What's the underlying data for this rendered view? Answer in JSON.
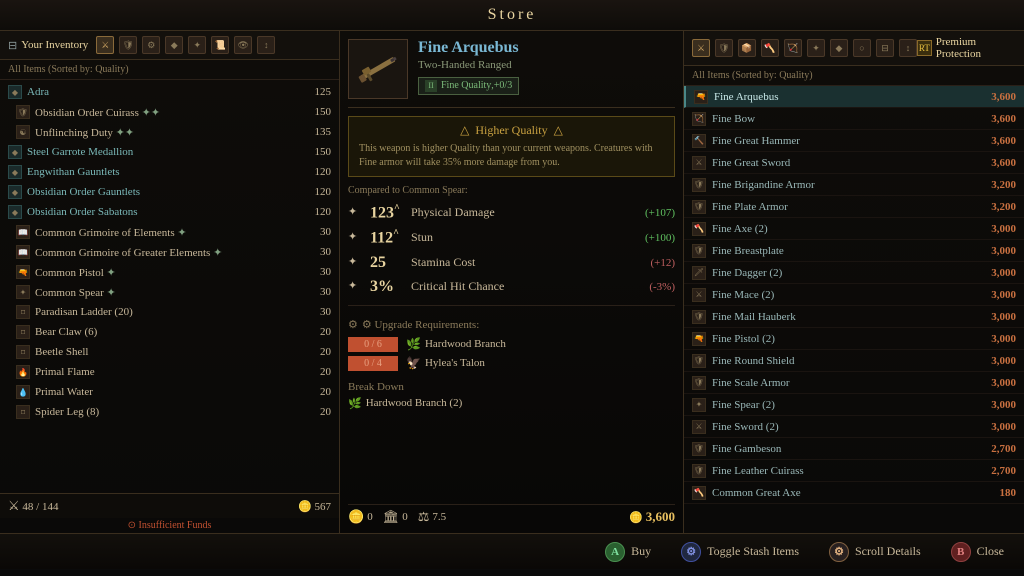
{
  "topbar": {
    "title": "Store",
    "left_hint": "◀",
    "right_hint": "▶"
  },
  "left_panel": {
    "header_title": "Your Inventory",
    "sort_label": "All Items (Sorted by: Quality)",
    "icons": [
      "⚔",
      "🛡",
      "⚙",
      "✦",
      "⚡",
      "🔮",
      "👁"
    ],
    "items": [
      {
        "name": "Adra",
        "price": "125",
        "special": false,
        "icon": "◆",
        "color": "teal"
      },
      {
        "name": "Obsidian Order Cuirass ✦✦",
        "price": "150",
        "special": false,
        "icon": "🛡",
        "color": "normal"
      },
      {
        "name": "Unflinching Duty ✦✦",
        "price": "135",
        "special": false,
        "icon": "☯",
        "color": "normal"
      },
      {
        "name": "Steel Garrote Medallion",
        "price": "150",
        "special": false,
        "icon": "◆",
        "color": "teal"
      },
      {
        "name": "Engwithan Gauntlets",
        "price": "120",
        "special": false,
        "icon": "◆",
        "color": "teal"
      },
      {
        "name": "Obsidian Order Gauntlets",
        "price": "120",
        "special": false,
        "icon": "◆",
        "color": "teal"
      },
      {
        "name": "Obsidian Order Sabatons",
        "price": "120",
        "special": false,
        "icon": "◆",
        "color": "teal"
      },
      {
        "name": "Common Grimoire of Elements ✦",
        "price": "30",
        "special": false,
        "icon": "📖",
        "color": "normal"
      },
      {
        "name": "Common Grimoire of Greater Elements ✦",
        "price": "30",
        "special": false,
        "icon": "📖",
        "color": "normal"
      },
      {
        "name": "Common Pistol ✦",
        "price": "30",
        "special": false,
        "icon": "🔫",
        "color": "normal"
      },
      {
        "name": "Common Spear ✦",
        "price": "30",
        "special": false,
        "icon": "✦",
        "color": "normal"
      },
      {
        "name": "Paradisan Ladder (20)",
        "price": "30",
        "special": false,
        "icon": "⌑",
        "color": "normal"
      },
      {
        "name": "Bear Claw (6)",
        "price": "20",
        "special": false,
        "icon": "⌑",
        "color": "normal"
      },
      {
        "name": "Beetle Shell",
        "price": "20",
        "special": false,
        "icon": "⌑",
        "color": "normal"
      },
      {
        "name": "Primal Flame",
        "price": "20",
        "special": false,
        "icon": "⌑",
        "color": "normal"
      },
      {
        "name": "Primal Water",
        "price": "20",
        "special": false,
        "icon": "⌑",
        "color": "normal"
      },
      {
        "name": "Spider Leg (8)",
        "price": "20",
        "special": false,
        "icon": "⌑",
        "color": "normal"
      }
    ],
    "footer_left": "⚔ 48 / 144",
    "footer_gold": "567",
    "insufficient_label": "⊙ Insufficient Funds"
  },
  "mid_panel": {
    "item_name": "Fine Arquebus",
    "item_type": "Two-Handed Ranged",
    "quality_label": "Fine Quality",
    "quality_upgrade": "+0/3",
    "higher_quality_title": "Higher Quality",
    "higher_quality_text": "This weapon is higher Quality than your current weapons. Creatures with Fine armor will take 35% more damage from you.",
    "compared_label": "Compared to Common Spear:",
    "stats": [
      {
        "icon": "✦",
        "value": "123",
        "modifier": "^",
        "name": "Physical Damage",
        "change": "+107",
        "positive": true
      },
      {
        "icon": "✦",
        "value": "112",
        "modifier": "^",
        "name": "Stun",
        "change": "+100",
        "positive": true
      },
      {
        "icon": "✦",
        "value": "25",
        "modifier": "",
        "name": "Stamina Cost",
        "change": "+12",
        "positive": false
      },
      {
        "icon": "✦",
        "value": "3%",
        "modifier": "",
        "name": "Critical Hit Chance",
        "change": "-3%",
        "positive": false
      }
    ],
    "upgrade_title": "⚙ Upgrade Requirements:",
    "upgrades": [
      {
        "current": "0",
        "max": "6",
        "name": "Hardwood Branch",
        "icon": "🌿"
      },
      {
        "current": "0",
        "max": "4",
        "name": "Hylea's Talon",
        "icon": "🦅"
      }
    ],
    "breakdown_title": "Break Down",
    "breakdown_items": [
      {
        "icon": "🌿",
        "name": "Hardwood Branch (2)"
      }
    ],
    "footer": {
      "copper": "0",
      "silver": "0",
      "weight": "7.5",
      "price": "3,600"
    }
  },
  "right_panel": {
    "header_title": "Premium Protection",
    "sort_label": "All Items (Sorted by: Quality)",
    "items": [
      {
        "name": "Fine Arquebus",
        "price": "3,600",
        "icon": "🔫",
        "selected": true
      },
      {
        "name": "Fine Bow",
        "price": "3,600",
        "icon": "🏹"
      },
      {
        "name": "Fine Great Hammer",
        "price": "3,600",
        "icon": "🔨"
      },
      {
        "name": "Fine Great Sword",
        "price": "3,600",
        "icon": "⚔"
      },
      {
        "name": "Fine Brigandine Armor",
        "price": "3,200",
        "icon": "🛡"
      },
      {
        "name": "Fine Plate Armor",
        "price": "3,200",
        "icon": "🛡"
      },
      {
        "name": "Fine Axe (2)",
        "price": "3,000",
        "icon": "🪓"
      },
      {
        "name": "Fine Breastplate",
        "price": "3,000",
        "icon": "🛡"
      },
      {
        "name": "Fine Dagger (2)",
        "price": "3,000",
        "icon": "🗡"
      },
      {
        "name": "Fine Mace (2)",
        "price": "3,000",
        "icon": "⚔"
      },
      {
        "name": "Fine Mail Hauberk",
        "price": "3,000",
        "icon": "🛡"
      },
      {
        "name": "Fine Pistol (2)",
        "price": "3,000",
        "icon": "🔫"
      },
      {
        "name": "Fine Round Shield",
        "price": "3,000",
        "icon": "🛡"
      },
      {
        "name": "Fine Scale Armor",
        "price": "3,000",
        "icon": "🛡"
      },
      {
        "name": "Fine Spear (2)",
        "price": "3,000",
        "icon": "✦"
      },
      {
        "name": "Fine Sword (2)",
        "price": "3,000",
        "icon": "⚔"
      },
      {
        "name": "Fine Gambeson",
        "price": "2,700",
        "icon": "🛡"
      },
      {
        "name": "Fine Leather Cuirass",
        "price": "2,700",
        "icon": "🛡"
      },
      {
        "name": "Common Great Axe",
        "price": "180",
        "icon": "🪓"
      }
    ]
  },
  "bottom_bar": {
    "buy_label": "Buy",
    "toggle_label": "Toggle Stash Items",
    "scroll_label": "Scroll Details",
    "close_label": "Close",
    "btn_a": "A",
    "btn_toggle": "⚙",
    "btn_scroll": "⚙",
    "btn_b": "B"
  }
}
